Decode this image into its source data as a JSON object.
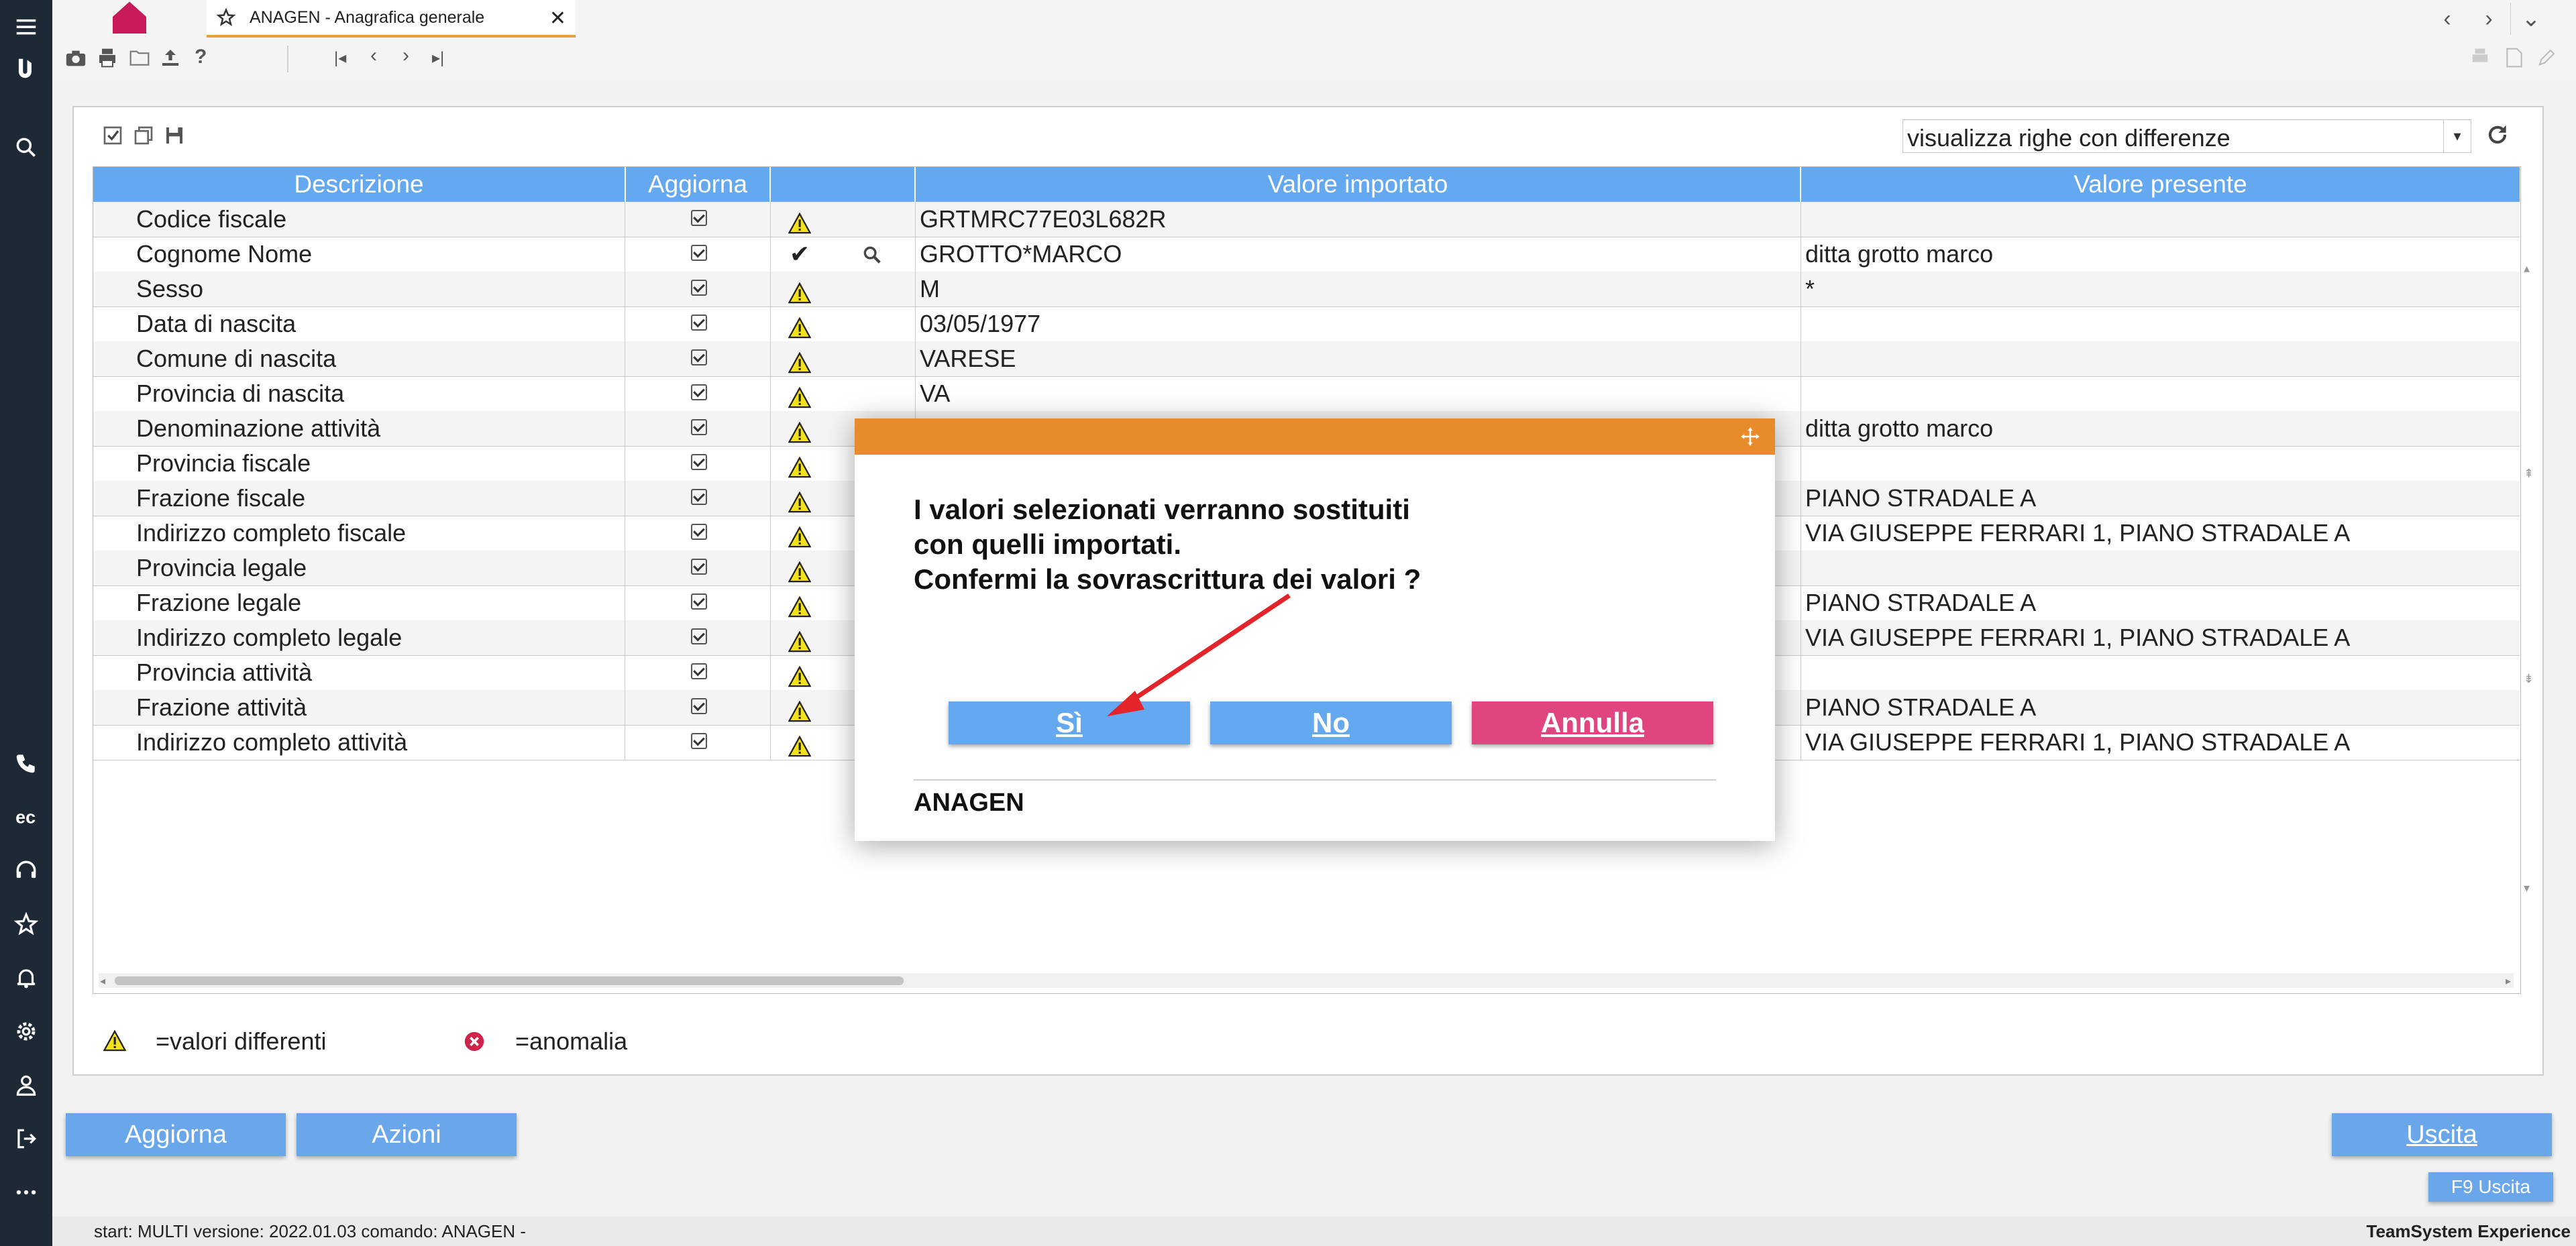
{
  "tabs": {
    "document_title": "ANAGEN - Anagrafica generale"
  },
  "filter": {
    "selected": "visualizza righe con differenze"
  },
  "grid": {
    "headers": [
      "Descrizione",
      "Aggiorna",
      "",
      "Valore importato",
      "Valore presente"
    ],
    "rows": [
      {
        "descr": "Codice fiscale",
        "status": "warning",
        "imported": "GRTMRC77E03L682R",
        "present": ""
      },
      {
        "descr": "Cognome Nome",
        "status": "ok",
        "imported": "GROTTO*MARCO",
        "present": "ditta grotto marco"
      },
      {
        "descr": "Sesso",
        "status": "warning",
        "imported": "M",
        "present": "*"
      },
      {
        "descr": "Data di nascita",
        "status": "warning",
        "imported": "03/05/1977",
        "present": ""
      },
      {
        "descr": "Comune di nascita",
        "status": "warning",
        "imported": "VARESE",
        "present": ""
      },
      {
        "descr": "Provincia di nascita",
        "status": "warning",
        "imported": "VA",
        "present": ""
      },
      {
        "descr": "Denominazione attività",
        "status": "warning",
        "imported": "",
        "present": "ditta grotto marco"
      },
      {
        "descr": "Provincia fiscale",
        "status": "warning",
        "imported": "",
        "present": ""
      },
      {
        "descr": "Frazione fiscale",
        "status": "warning",
        "imported": "",
        "present": "PIANO STRADALE A"
      },
      {
        "descr": "Indirizzo completo fiscale",
        "status": "warning",
        "imported": "",
        "present": "VIA GIUSEPPE FERRARI 1, PIANO STRADALE A"
      },
      {
        "descr": "Provincia legale",
        "status": "warning",
        "imported": "",
        "present": ""
      },
      {
        "descr": "Frazione legale",
        "status": "warning",
        "imported": "",
        "present": "PIANO STRADALE A"
      },
      {
        "descr": "Indirizzo completo legale",
        "status": "warning",
        "imported": "",
        "present": "VIA GIUSEPPE FERRARI 1, PIANO STRADALE A"
      },
      {
        "descr": "Provincia attività",
        "status": "warning",
        "imported": "",
        "present": ""
      },
      {
        "descr": "Frazione attività",
        "status": "warning",
        "imported": "",
        "present": "PIANO STRADALE A"
      },
      {
        "descr": "Indirizzo completo attività",
        "status": "warning",
        "imported": "",
        "present": "VIA GIUSEPPE FERRARI 1, PIANO STRADALE A"
      }
    ]
  },
  "legend": {
    "warning": "=valori differenti",
    "error": "=anomalia"
  },
  "dialog": {
    "line1": "I valori selezionati verranno sostituiti",
    "line2": "con quelli importati.",
    "line3": "Confermi la sovrascrittura dei valori ?",
    "yes": "Sì",
    "no": "No",
    "cancel": "Annulla",
    "footer": "ANAGEN"
  },
  "buttons": {
    "aggiorna": "Aggiorna",
    "azioni": "Azioni",
    "uscita": "Uscita",
    "f9": "F9 Uscita"
  },
  "status": {
    "left": "start: MULTI versione: 2022.01.03 comando: ANAGEN -",
    "right": "TeamSystem Experience"
  },
  "colors": {
    "header_blue": "#64a8f0",
    "dialog_orange": "#e88b2a",
    "cancel_pink": "#e0457f",
    "sidebar": "#1d2a35",
    "home_pink": "#c8195a"
  },
  "icons": [
    "menu-icon",
    "logo-icon",
    "search-icon",
    "phone-icon",
    "ec-icon",
    "headset-icon",
    "star-icon",
    "bell-icon",
    "gear-icon",
    "user-icon",
    "logout-icon",
    "more-icon",
    "home-icon",
    "camera-icon",
    "print-icon",
    "folder-icon",
    "upload-icon",
    "help-icon",
    "first-icon",
    "prev-icon",
    "next-icon",
    "last-icon",
    "refresh-icon",
    "warning-icon",
    "check-icon",
    "magnifier-icon",
    "error-icon",
    "move-icon"
  ]
}
